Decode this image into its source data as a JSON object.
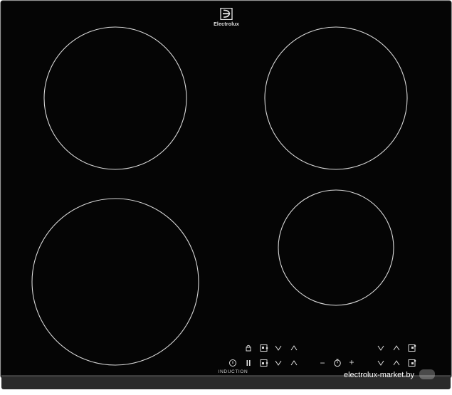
{
  "brand": {
    "name": "Electrolux",
    "logo_icon": "electrolux-logo-icon"
  },
  "technology_label": "INDUCTION",
  "cooking_zones": [
    {
      "id": "rear-left"
    },
    {
      "id": "rear-right"
    },
    {
      "id": "front-left"
    },
    {
      "id": "front-right"
    }
  ],
  "controls": {
    "lock_icon": "lock-icon",
    "pause_icon": "pause-icon",
    "power_icon": "power-icon",
    "timer_icon": "timer-icon",
    "minus_label": "−",
    "plus_label": "+",
    "zone_select_icon": "zone-select-icon",
    "down_icon": "chevron-down-icon",
    "up_icon": "chevron-up-icon"
  },
  "watermark": "electrolux-market.by",
  "colors": {
    "glass": "#050505",
    "frame_edge": "#2b2b2b",
    "markings": "#e0e0e0"
  }
}
